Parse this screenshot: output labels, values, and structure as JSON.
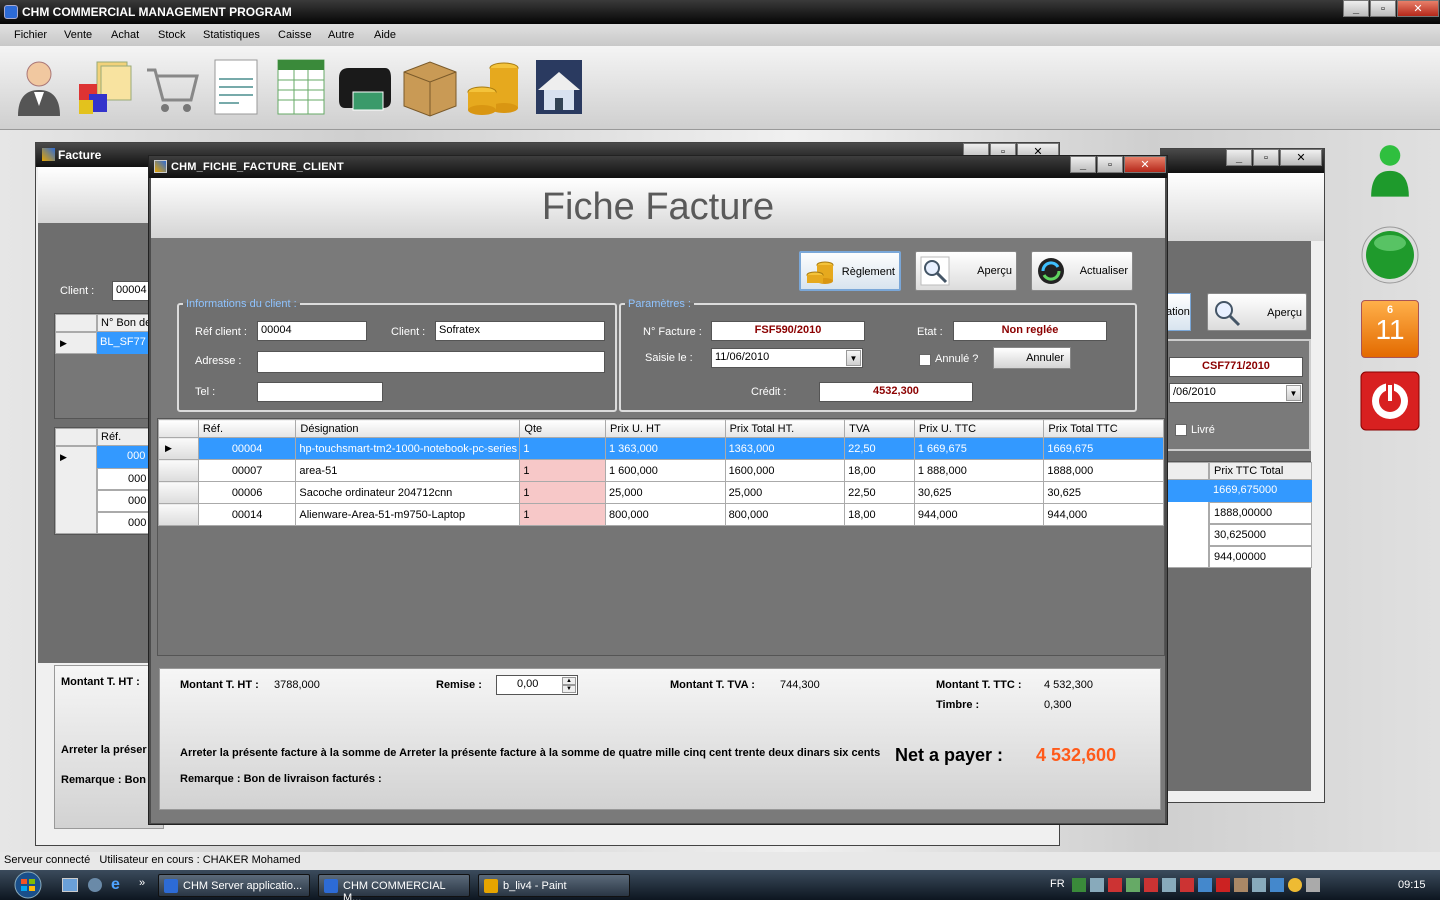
{
  "app": {
    "title": "CHM COMMERCIAL MANAGEMENT PROGRAM",
    "menu": [
      "Fichier",
      "Vente",
      "Achat",
      "Stock",
      "Statistiques",
      "Caisse",
      "Autre",
      "Aide"
    ],
    "toolbar_icons": [
      "user-icon",
      "boxes-icon",
      "cart-icon",
      "document-icon",
      "spreadsheet-icon",
      "wallet-icon",
      "package-icon",
      "coins-icon",
      "home-icon"
    ]
  },
  "side": {
    "calendar_month": "6",
    "calendar_day": "11"
  },
  "back_window": {
    "title": "Facture",
    "client_label": "Client :",
    "client_value": "00004",
    "bon_header": "N° Bon de",
    "bon_row": "BL_SF77",
    "ref_header": "Réf.",
    "ref_rows": [
      "000",
      "000",
      "000",
      "000"
    ],
    "montant_label": "Montant T. HT :",
    "arreter_label": "Arreter la préser",
    "remarque_label": "Remarque : Bon"
  },
  "right_window": {
    "btn_partial": "ation",
    "apercu": "Aperçu",
    "ref_value": "CSF771/2010",
    "date_partial": "/06/2010",
    "livre_label": "Livré",
    "col_header": "Prix TTC Total",
    "rows": [
      "1669,675000",
      "1888,00000",
      "30,625000",
      "944,00000"
    ]
  },
  "front": {
    "title": "CHM_FICHE_FACTURE_CLIENT",
    "heading": "Fiche Facture",
    "buttons": {
      "reglement": "Règlement",
      "apercu": "Aperçu",
      "actualiser": "Actualiser"
    },
    "client_group": {
      "legend": "Informations du client :",
      "ref_label": "Réf client :",
      "ref_value": "00004",
      "client_label": "Client :",
      "client_value": "Sofratex",
      "adresse_label": "Adresse :",
      "adresse_value": "",
      "tel_label": "Tel :",
      "tel_value": ""
    },
    "param_group": {
      "legend": "Paramètres :",
      "facture_label": "N° Facture :",
      "facture_value": "FSF590/2010",
      "etat_label": "Etat :",
      "etat_value": "Non reglée",
      "saisie_label": "Saisie le :",
      "saisie_value": "11/06/2010",
      "annule_label": "Annulé ?",
      "annuler_btn": "Annuler",
      "credit_label": "Crédit :",
      "credit_value": "4532,300"
    },
    "grid": {
      "headers": [
        "Réf.",
        "Désignation",
        "Qte",
        "Prix U. HT",
        "Prix Total HT.",
        "TVA",
        "Prix U. TTC",
        "Prix Total TTC"
      ],
      "rows": [
        [
          "00004",
          "hp-touchsmart-tm2-1000-notebook-pc-series",
          "1",
          "1 363,000",
          "1363,000",
          "22,50",
          "1 669,675",
          "1669,675"
        ],
        [
          "00007",
          "area-51",
          "1",
          "1 600,000",
          "1600,000",
          "18,00",
          "1 888,000",
          "1888,000"
        ],
        [
          "00006",
          "Sacoche ordinateur 204712cnn",
          "1",
          "25,000",
          "25,000",
          "22,50",
          "30,625",
          "30,625"
        ],
        [
          "00014",
          "Alienware-Area-51-m9750-Laptop",
          "1",
          "800,000",
          "800,000",
          "18,00",
          "944,000",
          "944,000"
        ]
      ]
    },
    "totals": {
      "ht_label": "Montant T. HT :",
      "ht_value": "3788,000",
      "remise_label": "Remise :",
      "remise_value": "0,00",
      "tva_label": "Montant T. TVA :",
      "tva_value": "744,300",
      "ttc_label": "Montant T. TTC :",
      "ttc_value": "4 532,300",
      "timbre_label": "Timbre :",
      "timbre_value": "0,300",
      "arreter_text": "Arreter la présente facture à la somme de Arreter la présente facture à la somme de quatre mille cinq cent trente deux dinars six cents",
      "net_label": "Net a payer :",
      "net_value": "4 532,600",
      "remarque_text": "Remarque : Bon de livraison facturés :"
    }
  },
  "status": {
    "text": "Serveur connecté   Utilisateur en cours : CHAKER Mohamed"
  },
  "taskbar": {
    "tasks": [
      "CHM Server applicatio...",
      "CHM COMMERCIAL M...",
      "b_liv4 - Paint"
    ],
    "lang": "FR",
    "clock": "09:15"
  },
  "colors": {
    "accent_red": "#8b0000",
    "net_orange": "#ff5a1a",
    "selection_blue": "#3399ff",
    "qty_pink": "#f7c8c8"
  }
}
